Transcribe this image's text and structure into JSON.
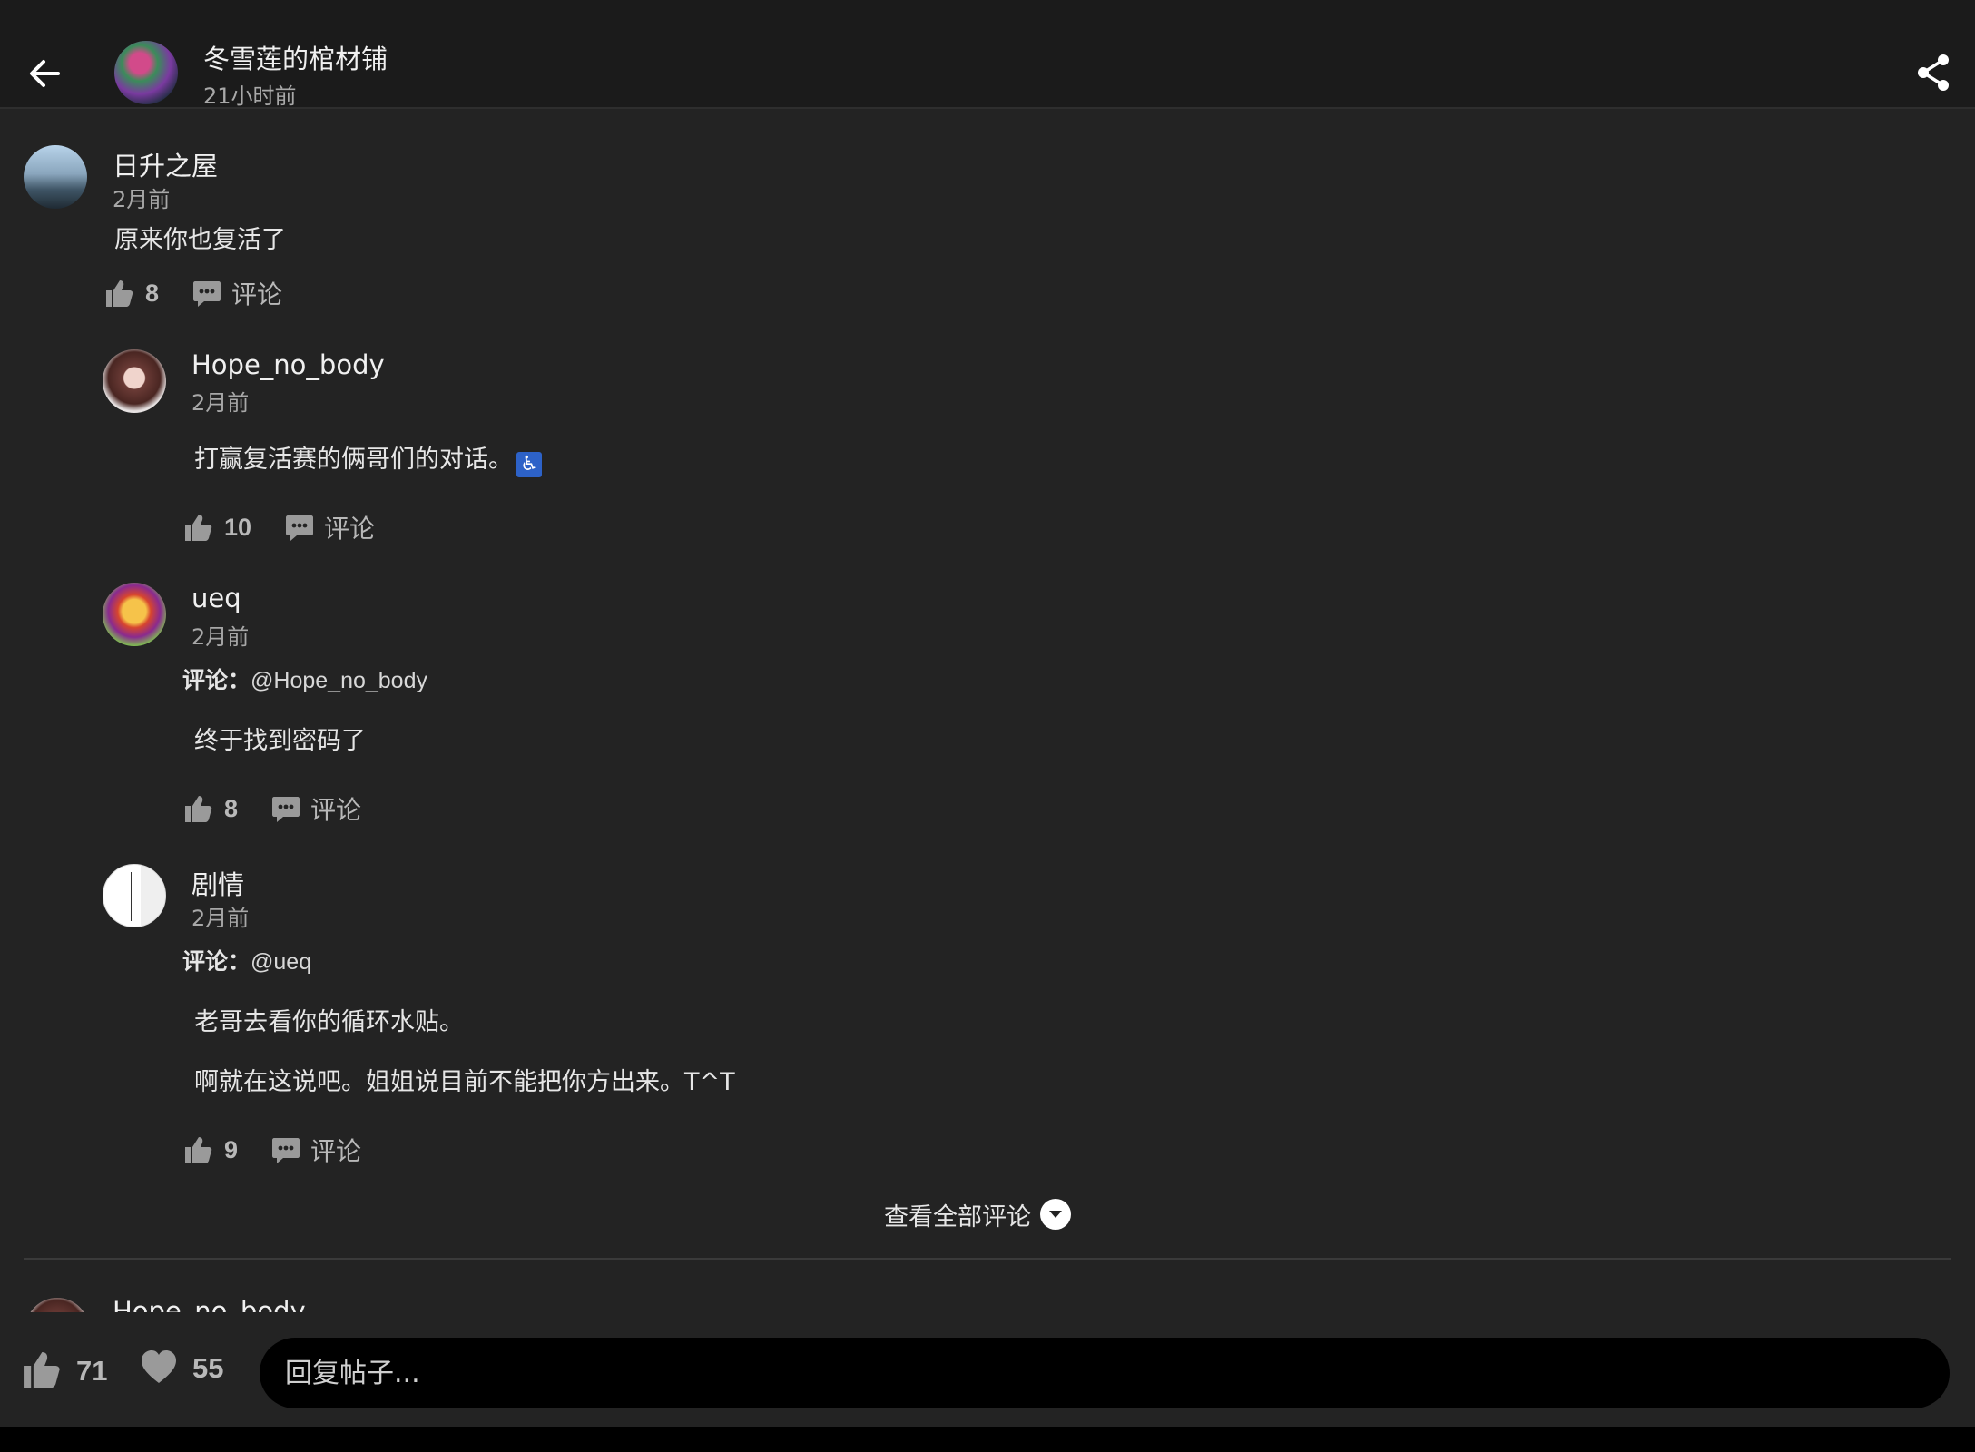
{
  "header": {
    "post_author": "冬雪莲的棺材铺",
    "post_time": "21小时前"
  },
  "comment": {
    "author": "日升之屋",
    "time": "2月前",
    "text": "原来你也复活了",
    "likes": "8",
    "comment_label": "评论"
  },
  "replies": [
    {
      "author": "Hope_no_body",
      "time": "2月前",
      "text": "打赢复活赛的俩哥们的对话。",
      "emoji": "♿",
      "likes": "10",
      "comment_label": "评论"
    },
    {
      "author": "ueq",
      "time": "2月前",
      "reply_prefix": "评论：",
      "reply_target": "@Hope_no_body",
      "text": "终于找到密码了",
      "likes": "8",
      "comment_label": "评论"
    },
    {
      "author": "剧情",
      "time": "2月前",
      "reply_prefix": "评论：",
      "reply_target": "@ueq",
      "text_line1": "老哥去看你的循环水贴。",
      "text_line2": "啊就在这说吧。姐姐说目前不能把你方出来。T^T",
      "likes": "9",
      "comment_label": "评论"
    }
  ],
  "view_all": "查看全部评论",
  "next_comment_author": "Hope_no_body",
  "bottom": {
    "likes": "71",
    "favorites": "55",
    "reply_placeholder": "回复帖子..."
  },
  "icons": [
    "back-arrow-icon",
    "share-icon",
    "thumbs-up-icon",
    "comment-bubble-icon",
    "chevron-down-icon",
    "heart-icon"
  ]
}
